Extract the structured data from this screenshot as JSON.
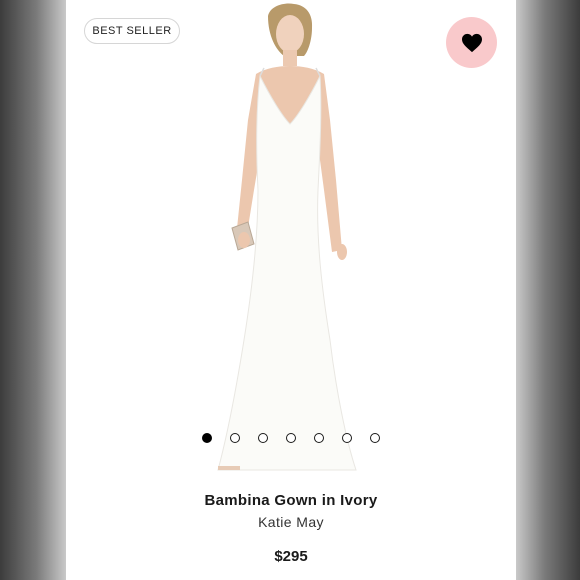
{
  "product": {
    "badge": "BEST SELLER",
    "title": "Bambina Gown in Ivory",
    "brand": "Katie May",
    "price": "$295",
    "favorite_icon": "heart-icon",
    "image_count": 7,
    "active_image": 1
  },
  "colors": {
    "favorite_bg": "#f9c9cb",
    "card_bg": "#ffffff",
    "text": "#1a1a1a"
  }
}
